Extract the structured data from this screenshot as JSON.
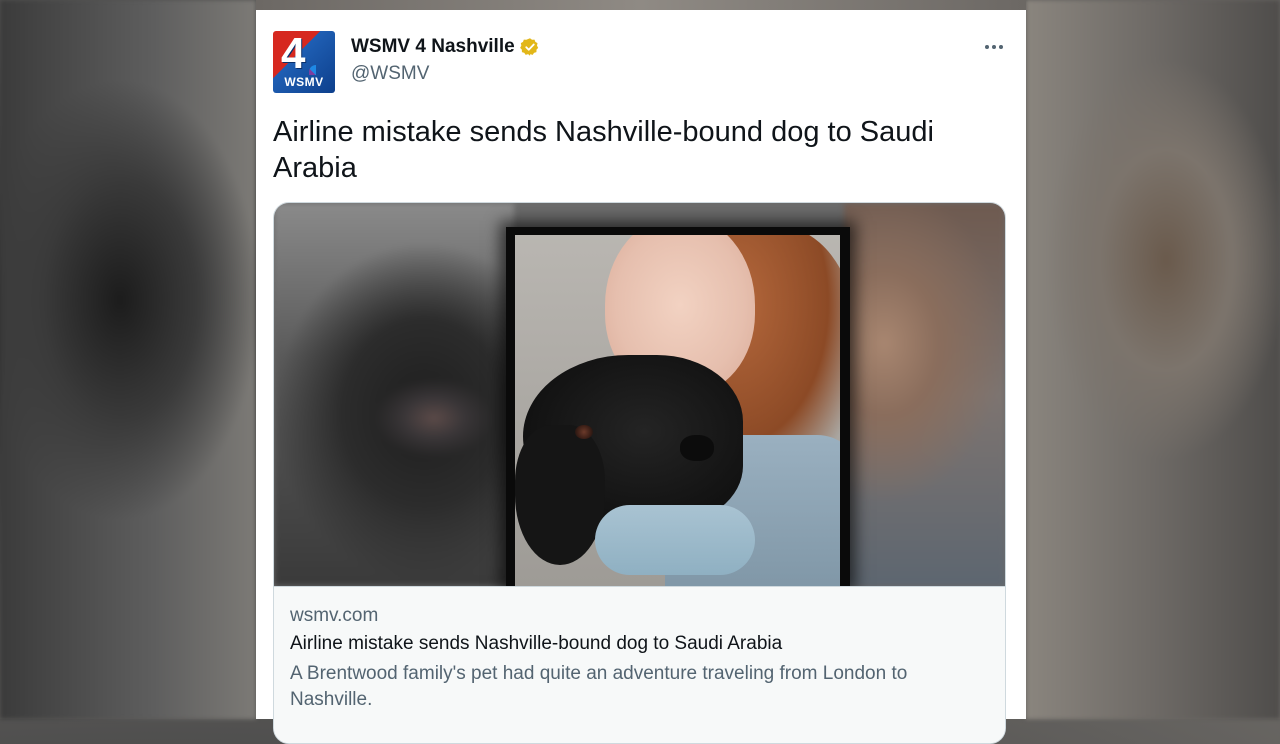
{
  "tweet": {
    "author_name": "WSMV 4 Nashville",
    "handle": "@WSMV",
    "verified": true,
    "verified_color": "#E2B719",
    "avatar": {
      "number": "4",
      "call_letters": "WSMV",
      "icon": "station-logo-icon"
    },
    "text": "Airline mistake sends Nashville-bound dog to Saudi Arabia",
    "more_icon": "more-options-icon"
  },
  "link_card": {
    "image_icon": "article-photo-woman-kissing-dog",
    "domain": "wsmv.com",
    "title": "Airline mistake sends Nashville-bound dog to Saudi Arabia",
    "description": "A Brentwood family's pet had quite an adventure traveling from London to Nashville."
  },
  "colors": {
    "text_primary": "#0F1419",
    "text_secondary": "#536471",
    "card_border": "#CFD9DE",
    "card_footer_bg": "#F7F9F9"
  }
}
